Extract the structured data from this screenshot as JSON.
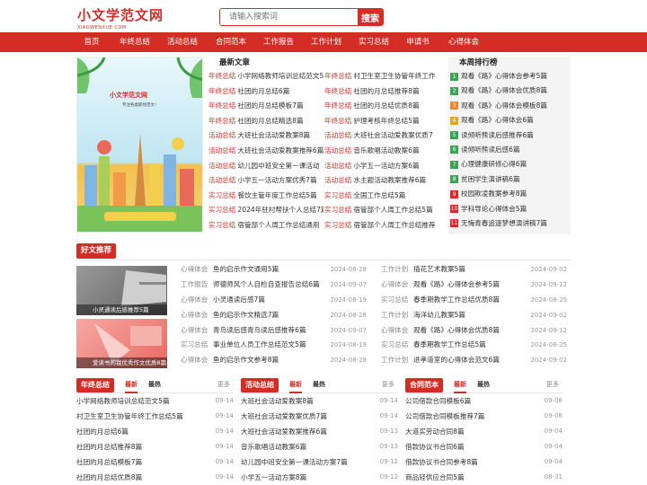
{
  "brand": {
    "name": "小文学范文网",
    "domain": "XIAOWENXUE.COM",
    "accent": "#d32d26"
  },
  "search": {
    "placeholder": "请输入搜索词",
    "button": "搜索"
  },
  "nav": [
    "首页",
    "年终总结",
    "活动总结",
    "合同范本",
    "工作报告",
    "工作计划",
    "实习总结",
    "申请书",
    "心得体会"
  ],
  "banner": {
    "logo": "小文学范文网",
    "slogan": "专注各类职场范文！"
  },
  "latest": {
    "title": "最新文章",
    "left": [
      [
        "年终总结",
        "小学网络教师培训总结范文5篇"
      ],
      [
        "年终总结",
        "社团的月总结6篇"
      ],
      [
        "年终总结",
        "社团的月总结模板7篇"
      ],
      [
        "年终总结",
        "社团的月总结精选8篇"
      ],
      [
        "活动总结",
        "大班社会活动爱教案8篇"
      ],
      [
        "活动总结",
        "大班社会活动爱教案推荐6篇"
      ],
      [
        "活动总结",
        "幼儿园中班安全第一课活动"
      ],
      [
        "活动总结",
        "小学五一活动方案优秀7篇"
      ],
      [
        "实习总结",
        "餐饮主管年度工作总结5篇"
      ],
      [
        "实习总结",
        "2024年驻村帮扶个人总结7篇"
      ],
      [
        "实习总结",
        "宿管部个人周工作总结通用"
      ]
    ],
    "right": [
      [
        "年终总结",
        "村卫生室卫生协管年终工作"
      ],
      [
        "年终总结",
        "社团的月总结推荐8篇"
      ],
      [
        "年终总结",
        "社团的月总结优质8篇"
      ],
      [
        "年终总结",
        "护理考核年终总结5篇"
      ],
      [
        "活动总结",
        "大班社会活动爱教案优质7"
      ],
      [
        "活动总结",
        "音乐歌唱活动教案6篇"
      ],
      [
        "活动总结",
        "小学五一活动方案6篇"
      ],
      [
        "活动总结",
        "水主题活动教案推荐6篇"
      ],
      [
        "实习总结",
        "全国工作总结5篇"
      ],
      [
        "实习总结",
        "宿管部个人周工作总结5篇"
      ],
      [
        "实习总结",
        "宿管部个人周工作总结推荐"
      ]
    ]
  },
  "rank": {
    "title": "本周排行榜",
    "items": [
      "观看《路》心得体会参考5篇",
      "观看《路》心得体会优质8篇",
      "观看《路》心得体会模板8篇",
      "观看《路》心得体会6篇",
      "读倾听熊读后感推荐6篇",
      "读倾听熊读后感6篇",
      "心理健康研修心得6篇",
      "贫困学生演讲稿6篇",
      "校园欺凌教案参考8篇",
      "学科导论心得体会5篇",
      "无悔青春追逐梦想演讲稿7篇"
    ],
    "colors": [
      "#3aa655",
      "#3aa655",
      "#f0862b",
      "#e6a628",
      "#3aa655",
      "#3aa655",
      "#3aa655",
      "#3aa655",
      "#d32d26",
      "#d32d26",
      "#d32d26"
    ]
  },
  "recommend": {
    "title": "好文推荐",
    "thumbs": [
      "小灵通读后感推荐5篇",
      "爱读书的我优秀作文优质8篇"
    ],
    "left": [
      [
        "心得体会",
        "鱼的启示作文通用5篇",
        "2024-08-28"
      ],
      [
        "工作报告",
        "师德师风个人自检自查报告总结6篇",
        "2024-09-07"
      ],
      [
        "心得体会",
        "小灵通读后感7篇",
        "2024-08-19"
      ],
      [
        "心得体会",
        "鱼的启示作文精选7篇",
        "2024-08-28"
      ],
      [
        "心得体会",
        "青鸟读后感青鸟读后感推荐6篇",
        "2024-09-07"
      ],
      [
        "实习总结",
        "事业单位人员工作总结范文5篇",
        "2024-08-19"
      ],
      [
        "心得体会",
        "鱼的启示作文参考8篇",
        "2024-08-28"
      ]
    ],
    "right": [
      [
        "工作计划",
        "插花艺术教案5篇",
        "2024-09-02"
      ],
      [
        "心得体会",
        "观看《路》心得体会参考5篇",
        "2024-09-12"
      ],
      [
        "实习总结",
        "春季期教学工作总结优质8篇",
        "2024-08-25"
      ],
      [
        "工作计划",
        "海洋幼儿教案5篇",
        "2024-09-02"
      ],
      [
        "心得体会",
        "观看《路》心得体会优质8篇",
        "2024-09-12"
      ],
      [
        "实习总结",
        "春季期教学工作总结5篇",
        "2024-08-25"
      ],
      [
        "工作计划",
        "进孝道室的心得体会范文6篇",
        "2024-09-02"
      ]
    ]
  },
  "columns": [
    {
      "title": "年终总结",
      "tab1": "最新",
      "tab2": "最热",
      "more": "更多",
      "items": [
        [
          "小学网络教师培训总结范文5篇",
          "09-14"
        ],
        [
          "村卫生室卫生协管年终工作总结5篇",
          "09-14"
        ],
        [
          "社团的月总结6篇",
          "09-14"
        ],
        [
          "社团的月总结推荐8篇",
          "09-14"
        ],
        [
          "社团的月总结模板7篇",
          "09-14"
        ],
        [
          "社团的月总结优质8篇",
          "09-14"
        ]
      ]
    },
    {
      "title": "活动总结",
      "tab1": "最新",
      "tab2": "最热",
      "more": "更多",
      "items": [
        [
          "大班社会活动爱教案8篇",
          "09-14"
        ],
        [
          "大班社会活动爱教案优质7篇",
          "09-14"
        ],
        [
          "大班社会活动爱教案推荐6篇",
          "09-13"
        ],
        [
          "音乐歌唱活动教案6篇",
          "09-13"
        ],
        [
          "幼儿园中班安全第一课活动方案7篇",
          "09-12"
        ],
        [
          "小学五一活动方案8篇",
          "09-12"
        ]
      ]
    },
    {
      "title": "合同范本",
      "tab1": "最新",
      "tab2": "最热",
      "more": "更多",
      "items": [
        [
          "公司借款合同模板6篇",
          "09-08"
        ],
        [
          "公司借款合同模板推荐7篇",
          "09-08"
        ],
        [
          "大道买劳动合同8篇",
          "09-04"
        ],
        [
          "借款协议书合同6篇",
          "09-04"
        ],
        [
          "借款协议书合同参考8篇",
          "09-04"
        ],
        [
          "商品轻供应合同5篇",
          "08-31"
        ]
      ]
    }
  ]
}
